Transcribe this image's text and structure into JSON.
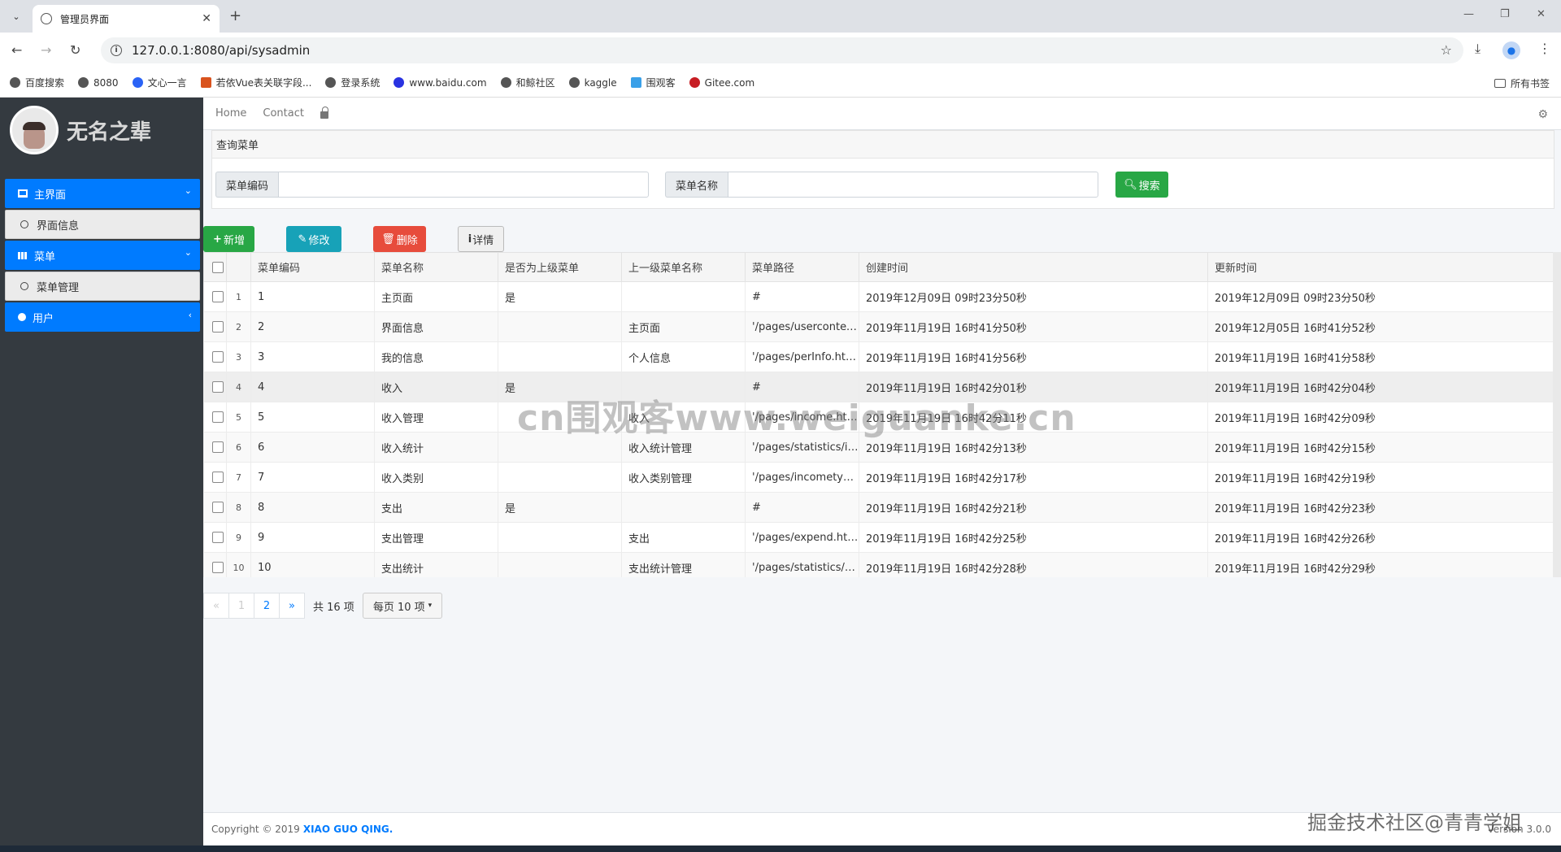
{
  "browser": {
    "tab_title": "管理员界面",
    "url": "127.0.0.1:8080/api/sysadmin",
    "bookmarks": [
      "百度搜索",
      "8080",
      "文心一言",
      "若依Vue表关联字段...",
      "登录系统",
      "www.baidu.com",
      "和鲸社区",
      "kaggle",
      "围观客",
      "Gitee.com"
    ],
    "all_bookmarks": "所有书签"
  },
  "sidebar": {
    "username": "无名之辈",
    "items": [
      {
        "label": "主界面"
      },
      {
        "label": "界面信息"
      },
      {
        "label": "菜单"
      },
      {
        "label": "菜单管理"
      },
      {
        "label": "用户"
      }
    ]
  },
  "topnav": {
    "home": "Home",
    "contact": "Contact"
  },
  "search": {
    "header": "查询菜单",
    "code_label": "菜单编码",
    "name_label": "菜单名称",
    "button": "搜索"
  },
  "toolbar": {
    "add": "新增",
    "edit": "修改",
    "delete": "删除",
    "detail": "详情"
  },
  "table": {
    "headers": [
      "菜单编码",
      "菜单名称",
      "是否为上级菜单",
      "上一级菜单名称",
      "菜单路径",
      "创建时间",
      "更新时间"
    ],
    "rows": [
      {
        "idx": "1",
        "code": "1",
        "name": "主页面",
        "is_parent": "是",
        "parent": "",
        "path": "#",
        "created": "2019年12月09日 09时23分50秒",
        "updated": "2019年12月09日 09时23分50秒"
      },
      {
        "idx": "2",
        "code": "2",
        "name": "界面信息",
        "is_parent": "",
        "parent": "主页面",
        "path": "'/pages/usercontext.html'",
        "created": "2019年11月19日 16时41分50秒",
        "updated": "2019年12月05日 16时41分52秒"
      },
      {
        "idx": "3",
        "code": "3",
        "name": "我的信息",
        "is_parent": "",
        "parent": "个人信息",
        "path": "'/pages/perInfo.html'",
        "created": "2019年11月19日 16时41分56秒",
        "updated": "2019年11月19日 16时41分58秒"
      },
      {
        "idx": "4",
        "code": "4",
        "name": "收入",
        "is_parent": "是",
        "parent": "",
        "path": "#",
        "created": "2019年11月19日 16时42分01秒",
        "updated": "2019年11月19日 16时42分04秒"
      },
      {
        "idx": "5",
        "code": "5",
        "name": "收入管理",
        "is_parent": "",
        "parent": "收入",
        "path": "'/pages/income.html'",
        "created": "2019年11月19日 16时42分11秒",
        "updated": "2019年11月19日 16时42分09秒"
      },
      {
        "idx": "6",
        "code": "6",
        "name": "收入统计",
        "is_parent": "",
        "parent": "收入统计管理",
        "path": "'/pages/statistics/income.html'",
        "created": "2019年11月19日 16时42分13秒",
        "updated": "2019年11月19日 16时42分15秒"
      },
      {
        "idx": "7",
        "code": "7",
        "name": "收入类别",
        "is_parent": "",
        "parent": "收入类别管理",
        "path": "'/pages/incometype.html'",
        "created": "2019年11月19日 16时42分17秒",
        "updated": "2019年11月19日 16时42分19秒"
      },
      {
        "idx": "8",
        "code": "8",
        "name": "支出",
        "is_parent": "是",
        "parent": "",
        "path": "#",
        "created": "2019年11月19日 16时42分21秒",
        "updated": "2019年11月19日 16时42分23秒"
      },
      {
        "idx": "9",
        "code": "9",
        "name": "支出管理",
        "is_parent": "",
        "parent": "支出",
        "path": "'/pages/expend.html'",
        "created": "2019年11月19日 16时42分25秒",
        "updated": "2019年11月19日 16时42分26秒"
      },
      {
        "idx": "10",
        "code": "10",
        "name": "支出统计",
        "is_parent": "",
        "parent": "支出统计管理",
        "path": "'/pages/statistics/expend.html'",
        "created": "2019年11月19日 16时42分28秒",
        "updated": "2019年11月19日 16时42分29秒"
      }
    ]
  },
  "pagination": {
    "prev": "«",
    "p1": "1",
    "p2": "2",
    "next": "»",
    "total": "共 16 项",
    "page_size": "每页 10 项"
  },
  "footer": {
    "copyright": "Copyright © 2019",
    "brand": "XIAO GUO QING.",
    "version": "Version 3.0.0"
  },
  "watermarks": {
    "center": "cn围观客www.weiguanke.cn",
    "corner": "掘金技术社区@青青学姐"
  }
}
